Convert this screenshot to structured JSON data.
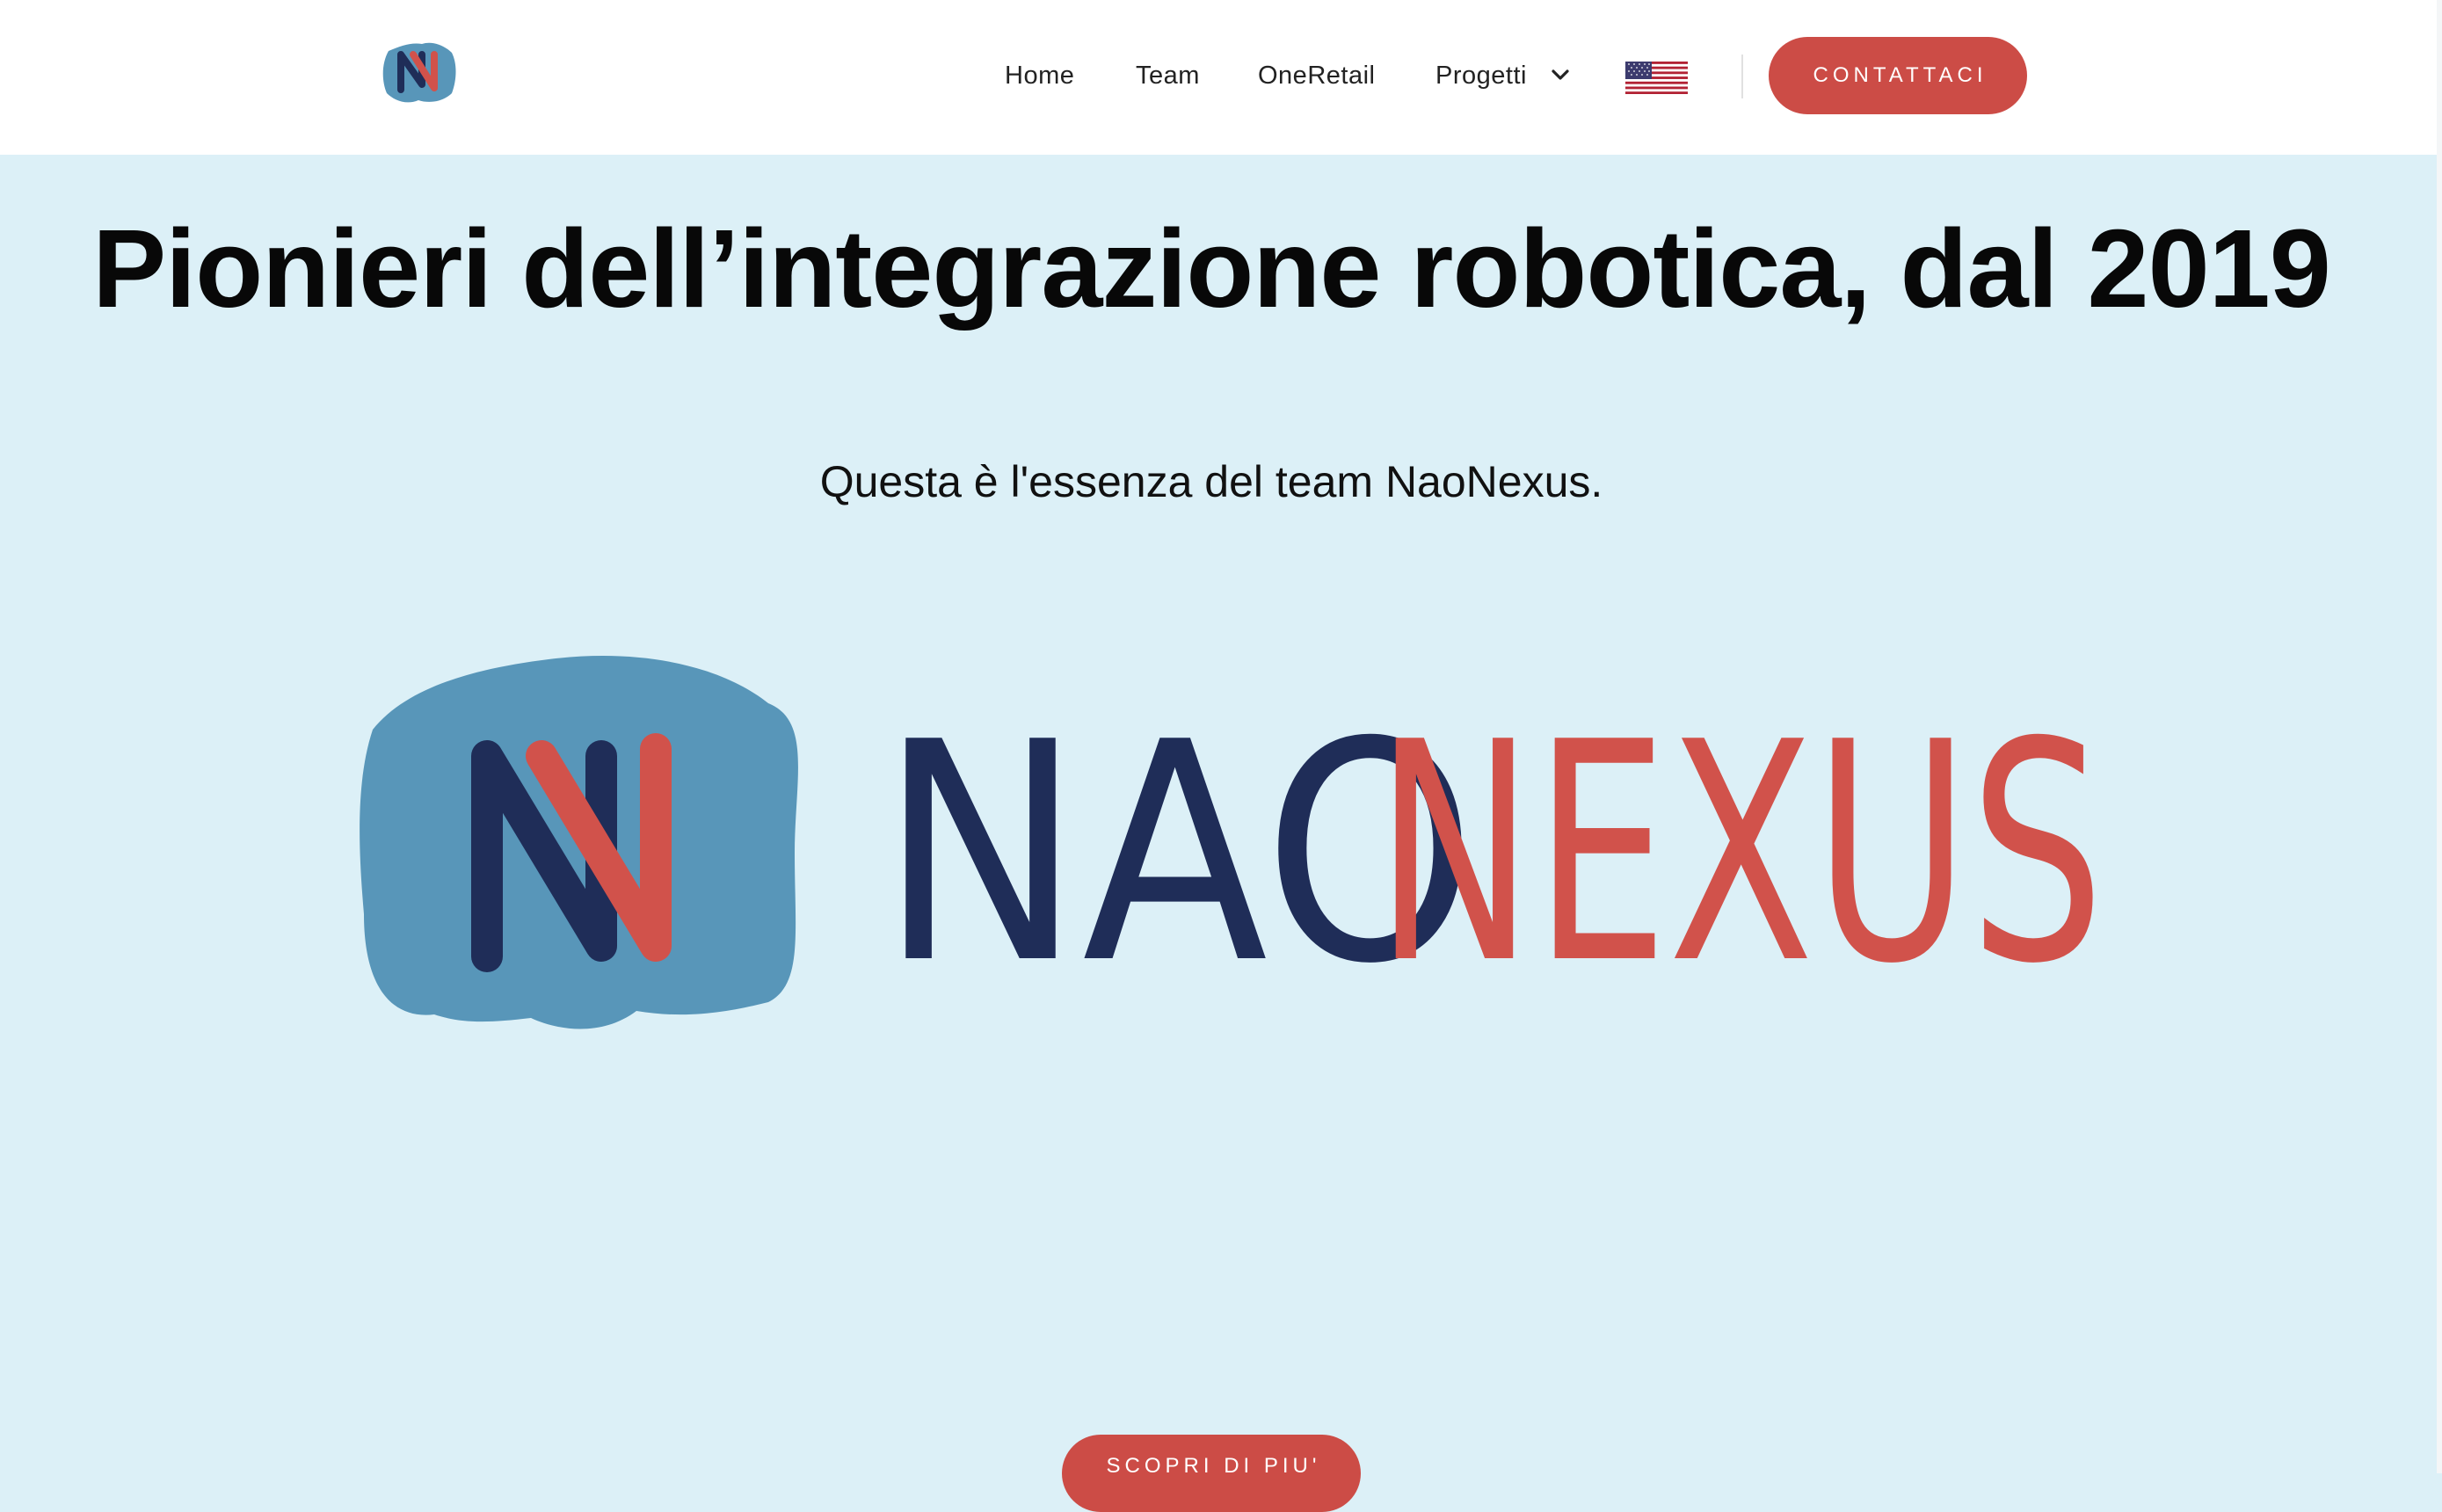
{
  "nav": {
    "items": [
      {
        "label": "Home"
      },
      {
        "label": "Team"
      },
      {
        "label": "OneRetail"
      },
      {
        "label": "Progetti"
      }
    ],
    "language_icon": "us-flag-icon",
    "dropdown_icon": "chevron-down-icon",
    "contact_label": "CONTATTACI"
  },
  "hero": {
    "title": "Pionieri dell’integrazione robotica, dal 2019",
    "subtitle": "Questa è l'essenza del team NaoNexus.",
    "logo_text_dark": "NAO",
    "logo_text_red": "NEXUS",
    "cta_label": "SCOPRI DI PIU'"
  },
  "colors": {
    "navy": "#1f2d58",
    "red": "#d1524b",
    "blue": "#5896b9",
    "background": "#dcf0f7",
    "button": "#cc4c46"
  }
}
